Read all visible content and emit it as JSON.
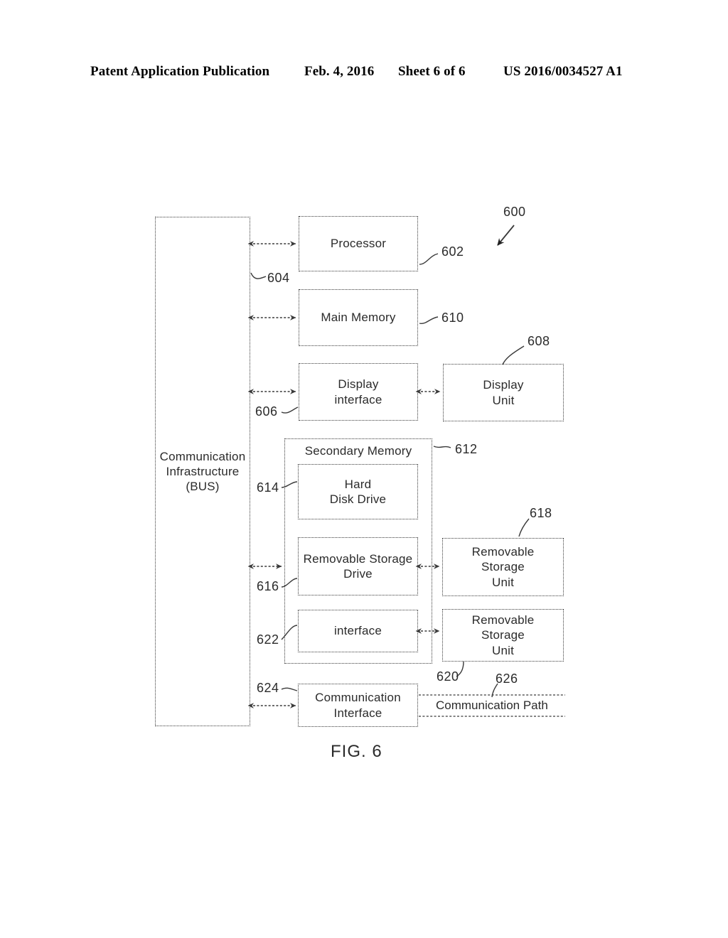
{
  "header": {
    "publication": "Patent Application Publication",
    "date": "Feb. 4, 2016",
    "sheet": "Sheet 6 of 6",
    "patent_number": "US 2016/0034527 A1"
  },
  "figure": {
    "caption": "FIG. 6",
    "system_numeral": "600",
    "blocks": {
      "bus": "Communication\nInfrastructure\n(BUS)",
      "bus_line1": "Communication",
      "bus_line2": "Infrastructure",
      "bus_line3": "(BUS)",
      "processor": "Processor",
      "main_memory": "Main Memory",
      "display_interface_line1": "Display",
      "display_interface_line2": "interface",
      "display_unit_line1": "Display",
      "display_unit_line2": "Unit",
      "secondary_memory": "Secondary Memory",
      "hard_disk_drive_line1": "Hard",
      "hard_disk_drive_line2": "Disk Drive",
      "removable_storage_drive_line1": "Removable Storage",
      "removable_storage_drive_line2": "Drive",
      "removable_storage_unit_618_line1": "Removable",
      "removable_storage_unit_618_line2": "Storage",
      "removable_storage_unit_618_line3": "Unit",
      "interface": "interface",
      "removable_storage_unit_620_line1": "Removable",
      "removable_storage_unit_620_line2": "Storage",
      "removable_storage_unit_620_line3": "Unit",
      "communication_interface_line1": "Communication",
      "communication_interface_line2": "Interface",
      "communication_path": "Communication Path"
    },
    "numerals": {
      "n600": "600",
      "n602": "602",
      "n604": "604",
      "n606": "606",
      "n608": "608",
      "n610": "610",
      "n612": "612",
      "n614": "614",
      "n616": "616",
      "n618": "618",
      "n620": "620",
      "n622": "622",
      "n624": "624",
      "n626": "626"
    },
    "colors": {
      "line": "#3a3a3a",
      "text": "#2b2b2b",
      "background": "#ffffff"
    }
  }
}
